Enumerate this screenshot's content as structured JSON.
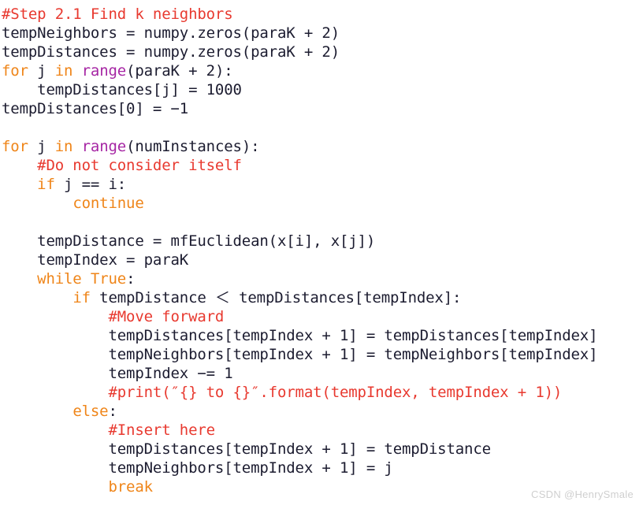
{
  "editor": {
    "language": "python",
    "background_color": "#ffffff",
    "colors": {
      "plain": "#1c1c30",
      "comment": "#e8392f",
      "keyword": "#ef8519",
      "builtin": "#a626a4",
      "string": "#e8392f"
    },
    "lines": [
      {
        "id": "line-1",
        "tokens": [
          {
            "t": "#Step 2.1 Find k neighbors",
            "c": "comment"
          }
        ]
      },
      {
        "id": "line-2",
        "tokens": [
          {
            "t": "tempNeighbors = numpy.zeros(paraK + 2)",
            "c": "plain"
          }
        ]
      },
      {
        "id": "line-3",
        "tokens": [
          {
            "t": "tempDistances = numpy.zeros(paraK + 2)",
            "c": "plain"
          }
        ]
      },
      {
        "id": "line-4",
        "tokens": [
          {
            "t": "for",
            "c": "keyword"
          },
          {
            "t": " j ",
            "c": "plain"
          },
          {
            "t": "in",
            "c": "keyword"
          },
          {
            "t": " ",
            "c": "plain"
          },
          {
            "t": "range",
            "c": "builtin"
          },
          {
            "t": "(paraK + 2):",
            "c": "plain"
          }
        ]
      },
      {
        "id": "line-5",
        "tokens": [
          {
            "t": "    tempDistances[j] = 1000",
            "c": "plain"
          }
        ]
      },
      {
        "id": "line-6",
        "tokens": [
          {
            "t": "tempDistances[0] = −1",
            "c": "plain"
          }
        ]
      },
      {
        "id": "line-7",
        "tokens": [
          {
            "t": "",
            "c": "plain"
          }
        ]
      },
      {
        "id": "line-8",
        "tokens": [
          {
            "t": "for",
            "c": "keyword"
          },
          {
            "t": " j ",
            "c": "plain"
          },
          {
            "t": "in",
            "c": "keyword"
          },
          {
            "t": " ",
            "c": "plain"
          },
          {
            "t": "range",
            "c": "builtin"
          },
          {
            "t": "(numInstances):",
            "c": "plain"
          }
        ]
      },
      {
        "id": "line-9",
        "tokens": [
          {
            "t": "    ",
            "c": "plain"
          },
          {
            "t": "#Do not consider itself",
            "c": "comment"
          }
        ]
      },
      {
        "id": "line-10",
        "tokens": [
          {
            "t": "    ",
            "c": "plain"
          },
          {
            "t": "if",
            "c": "keyword"
          },
          {
            "t": " j == i:",
            "c": "plain"
          }
        ]
      },
      {
        "id": "line-11",
        "tokens": [
          {
            "t": "        ",
            "c": "plain"
          },
          {
            "t": "continue",
            "c": "keyword"
          }
        ]
      },
      {
        "id": "line-12",
        "tokens": [
          {
            "t": "",
            "c": "plain"
          }
        ]
      },
      {
        "id": "line-13",
        "tokens": [
          {
            "t": "    tempDistance = mfEuclidean(x[i], x[j])",
            "c": "plain"
          }
        ]
      },
      {
        "id": "line-14",
        "tokens": [
          {
            "t": "    tempIndex = paraK",
            "c": "plain"
          }
        ]
      },
      {
        "id": "line-15",
        "tokens": [
          {
            "t": "    ",
            "c": "plain"
          },
          {
            "t": "while",
            "c": "keyword"
          },
          {
            "t": " ",
            "c": "plain"
          },
          {
            "t": "True",
            "c": "keyword"
          },
          {
            "t": ":",
            "c": "plain"
          }
        ]
      },
      {
        "id": "line-16",
        "tokens": [
          {
            "t": "        ",
            "c": "plain"
          },
          {
            "t": "if",
            "c": "keyword"
          },
          {
            "t": " tempDistance ＜ tempDistances[tempIndex]:",
            "c": "plain"
          }
        ]
      },
      {
        "id": "line-17",
        "tokens": [
          {
            "t": "            ",
            "c": "plain"
          },
          {
            "t": "#Move forward",
            "c": "comment"
          }
        ]
      },
      {
        "id": "line-18",
        "tokens": [
          {
            "t": "            tempDistances[tempIndex + 1] = tempDistances[tempIndex]",
            "c": "plain"
          }
        ]
      },
      {
        "id": "line-19",
        "tokens": [
          {
            "t": "            tempNeighbors[tempIndex + 1] = tempNeighbors[tempIndex]",
            "c": "plain"
          }
        ]
      },
      {
        "id": "line-20",
        "tokens": [
          {
            "t": "            tempIndex −= 1",
            "c": "plain"
          }
        ]
      },
      {
        "id": "line-21",
        "tokens": [
          {
            "t": "            ",
            "c": "plain"
          },
          {
            "t": "#print(″{} to {}″.format(tempIndex, tempIndex + 1))",
            "c": "comment"
          }
        ]
      },
      {
        "id": "line-22",
        "tokens": [
          {
            "t": "        ",
            "c": "plain"
          },
          {
            "t": "else",
            "c": "keyword"
          },
          {
            "t": ":",
            "c": "plain"
          }
        ]
      },
      {
        "id": "line-23",
        "tokens": [
          {
            "t": "            ",
            "c": "plain"
          },
          {
            "t": "#Insert here",
            "c": "comment"
          }
        ]
      },
      {
        "id": "line-24",
        "tokens": [
          {
            "t": "            tempDistances[tempIndex + 1] = tempDistance",
            "c": "plain"
          }
        ]
      },
      {
        "id": "line-25",
        "tokens": [
          {
            "t": "            tempNeighbors[tempIndex + 1] = j",
            "c": "plain"
          }
        ]
      },
      {
        "id": "line-26",
        "tokens": [
          {
            "t": "            ",
            "c": "plain"
          },
          {
            "t": "break",
            "c": "keyword"
          }
        ]
      }
    ]
  },
  "watermark": {
    "text": "CSDN @HenrySmale",
    "color": "#cfcfcf"
  }
}
